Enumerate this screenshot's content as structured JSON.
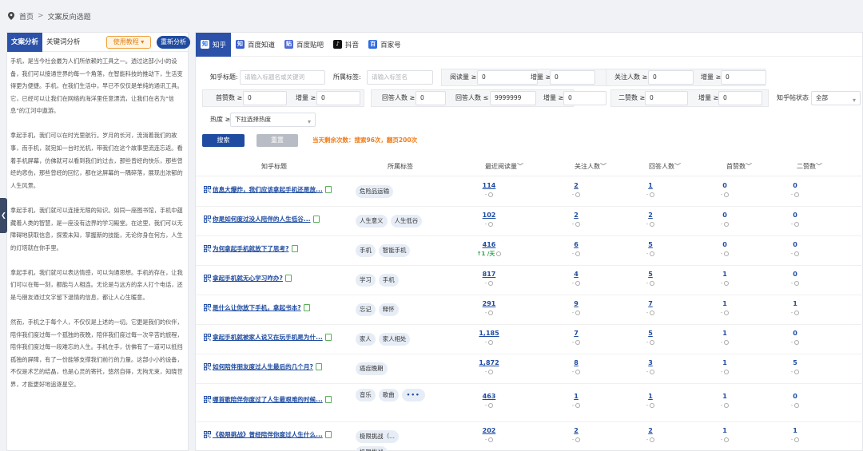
{
  "breadcrumb": {
    "home": "首页",
    "sep": ">",
    "current": "文案反向选题"
  },
  "left": {
    "tab_active": "文案分析",
    "tab_keyword": "关键词分析",
    "guide_btn": "使用教程",
    "guide_caret": "▾",
    "redo_btn": "重新分析",
    "collapse": "❮",
    "paragraphs": [
      "手机，是当今社会最为人们所依赖的工具之一。透过这部小小的设备，我们可以接通世界的每一个角落，在智能科技的推动下，生活变得更为便捷。手机，在我们生活中，早已不仅仅是单纯的通讯工具。它，已经可以让我们在网络的海洋里任意漂流，让我们在名为“信息”的江河中遨游。",
      "拿起手机，我们可以在时光里航行。岁月的长河，流淌着我们的故事，而手机，就宛如一台时光机，带我们在这个故事里流连忘返。看着手机屏幕，仿佛就可以看到我们的过去，那些曾经的快乐，那些曾经的悲伤，那些曾经的回忆，都在这屏幕的一隅碎落，展现出浓郁的人生风景。",
      "拿起手机，我们就可以连接无限的知识。如同一座图书馆，手机中蕴藏着人类的智慧，是一座没有边界的学习殿堂。在这里，我们可以无障碍地获取信息，探索未知，掌握新的技能，无论你身在何方，人生的灯塔就在你手里。",
      "拿起手机，我们就可以表达情感，可以沟通思想。手机的存在，让我们可以在每一刻，都能与人相连。无论是与远方的亲人打个电话，还是与朋友通过文字留下温情的信息，都让人心生暖意。",
      "然而，手机之于每个人，不仅仅是上述的一切。它更是我们的伙伴，陪伴我们度过每一个孤独的夜晚，陪伴我们度过每一次辛苦的旅程，陪伴我们度过每一段难忘的人生。手机在手，仿佛有了一道可以抵挡孤独的屏障，有了一份能够支撑我们前行的力量。这部小小的设备，不仅是术艺的结晶，也是心灵的寄托，悠然自得，无拘无束，知晓世界，才能更好地追逐星空。"
    ]
  },
  "platform_tabs": [
    {
      "label": "知乎",
      "icon": "zhihu-icon",
      "glyph": "知",
      "color": "#1772f6",
      "active": true
    },
    {
      "label": "百度知道",
      "icon": "baidu-zhidao-icon",
      "glyph": "知",
      "color": "#3a5fcd",
      "active": false
    },
    {
      "label": "百度贴吧",
      "icon": "baidu-tieba-icon",
      "glyph": "贴",
      "color": "#4f6bd8",
      "active": false
    },
    {
      "label": "抖音",
      "icon": "douyin-icon",
      "glyph": "♪",
      "color": "#111111",
      "active": false
    },
    {
      "label": "百家号",
      "icon": "baijiahao-icon",
      "glyph": "百",
      "color": "#2f6be0",
      "active": false
    }
  ],
  "filters": {
    "title_label": "知乎标题:",
    "title_ph": "请输入标题名或关键词",
    "tag_label": "所属标签:",
    "tag_ph": "请输入标签名",
    "read_label": "阅读量 ≥",
    "read_val": "0",
    "inc1_label": "增量 ≥",
    "inc1_val": "0",
    "follow_label": "关注人数 ≥",
    "follow_val": "0",
    "inc2_label": "增量 ≥",
    "inc2_val": "0",
    "top_label": "首赞数 ≥",
    "top_val": "0",
    "inc3_label": "增量 ≥",
    "inc3_val": "0",
    "ans_label": "回答人数 ≥",
    "ans_val": "0",
    "ans_max_label": "回答人数 ≤",
    "ans_max_val": "9999999",
    "inc4_label": "增量 ≥",
    "inc4_val": "0",
    "second_label": "二赞数 ≥",
    "second_val": "0",
    "inc5_label": "增量 ≥",
    "inc5_val": "0",
    "status_label": "知乎帖状态",
    "status_val": "全部",
    "heat_label": "热度 ≥",
    "heat_ph": "下拉选择热度",
    "search_btn": "搜索",
    "reset_btn": "重置",
    "remaining": "当天剩余次数：搜索96次，翻页200次",
    "arrow": "▾"
  },
  "table": {
    "headers": {
      "title": "知乎标题",
      "tags": "所属标签",
      "read": "最近阅读量﹀",
      "follow": "关注人数﹀",
      "answers": "回答人数﹀",
      "top": "首赞数﹀",
      "second": "二赞数﹀"
    },
    "dash": "-",
    "rows": [
      {
        "title": "信息大爆炸，我们应该拿起手机还是放...",
        "tags": [
          "危险品运输"
        ],
        "read": "114",
        "read_sub": "-",
        "follow": "2",
        "answers": "1",
        "top": "0",
        "second": "0"
      },
      {
        "title": "你是如何度过没人陪伴的人生低谷...",
        "tags": [
          "人生意义",
          "人生低谷"
        ],
        "read": "102",
        "read_sub": "-",
        "follow": "2",
        "answers": "2",
        "top": "0",
        "second": "0"
      },
      {
        "title": "为何拿起手机就放下了思考?",
        "tags": [
          "手机",
          "智能手机"
        ],
        "read": "416",
        "read_sub": "↑1 /天",
        "read_trend": true,
        "follow": "6",
        "answers": "5",
        "top": "0",
        "second": "0"
      },
      {
        "title": "拿起手机就无心学习咋办?",
        "tags": [
          "学习",
          "手机"
        ],
        "read": "817",
        "read_sub": "-",
        "follow": "4",
        "answers": "5",
        "top": "1",
        "second": "0"
      },
      {
        "title": "是什么让你放下手机，拿起书本?",
        "tags": [
          "忘记",
          "释怀"
        ],
        "read": "291",
        "read_sub": "-",
        "follow": "9",
        "answers": "7",
        "top": "1",
        "second": "1"
      },
      {
        "title": "拿起手机就被家人说又在玩手机是为什...",
        "tags": [
          "家人",
          "家人相处"
        ],
        "read": "1,185",
        "read_sub": "-",
        "follow": "7",
        "answers": "5",
        "top": "1",
        "second": "0"
      },
      {
        "title": "如何陪伴朋友度过人生最后的几个月?",
        "tags": [
          "癌症晚期"
        ],
        "read": "1,872",
        "read_sub": "-",
        "follow": "8",
        "answers": "3",
        "top": "1",
        "second": "5"
      },
      {
        "title": "哪首歌陪伴你度过了人生最艰难的时候...",
        "tags": [
          "音乐",
          "歌曲"
        ],
        "more": "•••",
        "tall": true,
        "read": "463",
        "read_sub": "-",
        "follow": "1",
        "answers": "1",
        "top": "1",
        "second": "0"
      },
      {
        "title": "《极限挑战》曾经陪伴你度过人生什么...",
        "tags": [
          "极限挑战（...",
          "极限挑战"
        ],
        "read": "202",
        "read_sub": "-",
        "follow": "2",
        "answers": "2",
        "top": "1",
        "second": "1"
      }
    ]
  }
}
